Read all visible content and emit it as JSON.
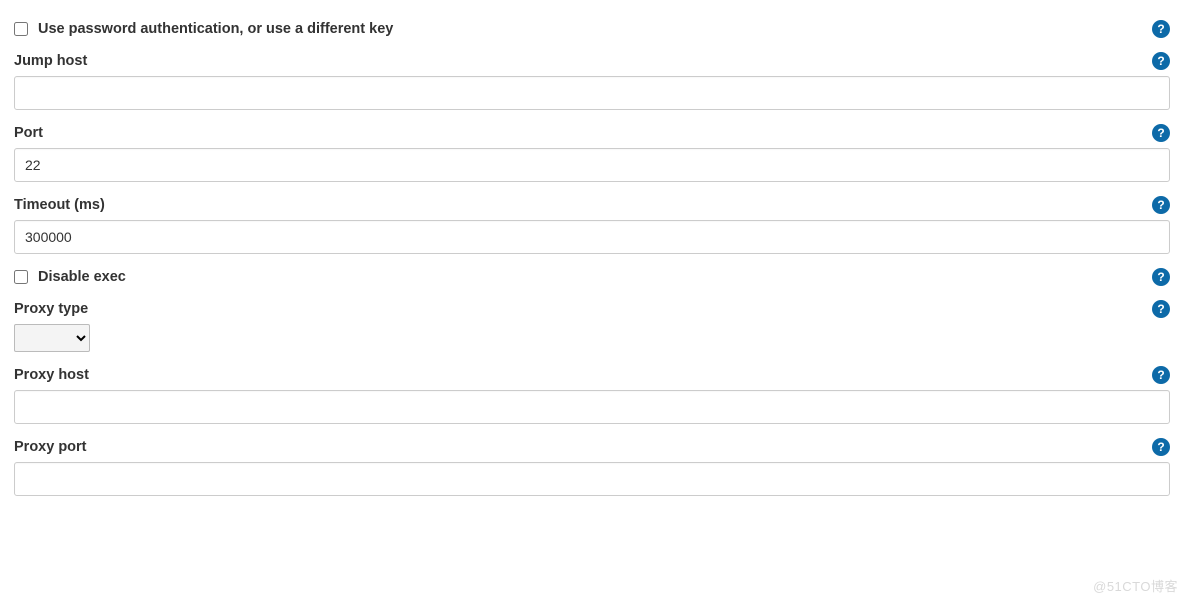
{
  "fields": {
    "password_auth": {
      "label": "Use password authentication, or use a different key",
      "checked": false
    },
    "jump_host": {
      "label": "Jump host",
      "value": ""
    },
    "port": {
      "label": "Port",
      "value": "22"
    },
    "timeout": {
      "label": "Timeout (ms)",
      "value": "300000"
    },
    "disable_exec": {
      "label": "Disable exec",
      "checked": false
    },
    "proxy_type": {
      "label": "Proxy type",
      "value": ""
    },
    "proxy_host": {
      "label": "Proxy host",
      "value": ""
    },
    "proxy_port": {
      "label": "Proxy port",
      "value": ""
    }
  },
  "help_icon_glyph": "?",
  "watermark": "@51CTO博客"
}
